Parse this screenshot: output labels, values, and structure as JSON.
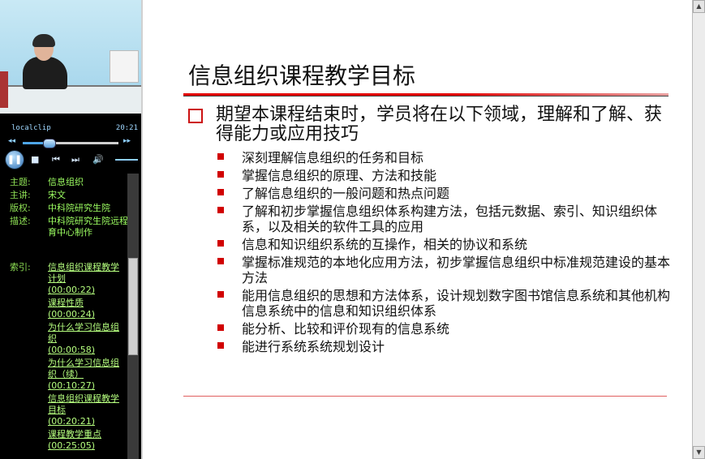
{
  "player": {
    "clip_name": "localclip",
    "time": "20:21",
    "progress_fraction": 0.27,
    "buttons": {
      "pause": "❚❚",
      "stop": "■",
      "prev": "⏮",
      "next": "⏭",
      "volume": "🔊",
      "rewind": "◂◂",
      "forward": "▸▸"
    },
    "icons": [
      "pause-icon",
      "stop-icon",
      "previous-icon",
      "next-icon",
      "volume-icon"
    ]
  },
  "meta": {
    "subject_label": "主题:",
    "subject_value": "信息组织",
    "speaker_label": "主讲:",
    "speaker_value": "宋文",
    "copyright_label": "版权:",
    "copyright_value": "中科院研究生院",
    "desc_label": "描述:",
    "desc_value": "中科院研究生院远程教育中心制作"
  },
  "index": {
    "label": "索引:",
    "items": [
      {
        "title": "信息组织课程教学计划",
        "time": "(00:00:22)"
      },
      {
        "title": "课程性质",
        "time": "(00:00:24)"
      },
      {
        "title": "为什么学习信息组织",
        "time": "(00:00:58)"
      },
      {
        "title": "为什么学习信息组织（续）",
        "time": "(00:10:27)"
      },
      {
        "title": "信息组织课程教学目标",
        "time": "(00:20:21)"
      },
      {
        "title": "课程教学重点",
        "time": "(00:25:05)"
      }
    ]
  },
  "slide": {
    "title": "信息组织课程教学目标",
    "main_point": "期望本课程结束时，学员将在以下领域，理解和了解、获得能力或应用技巧",
    "sub_points": [
      "深刻理解信息组织的任务和目标",
      "掌握信息组织的原理、方法和技能",
      "了解信息组织的一般问题和热点问题",
      "了解和初步掌握信息组织体系构建方法，包括元数据、索引、知识组织体系，以及相关的软件工具的应用",
      "信息和知识组织系统的互操作，相关的协议和系统",
      "掌握标准规范的本地化应用方法，初步掌握信息组织中标准规范建设的基本方法",
      "能用信息组织的思想和方法体系，设计规划数字图书馆信息系统和其他机构信息系统中的信息和知识组织体系",
      "能分析、比较和评价现有的信息系统",
      "能进行系统系统规划设计"
    ],
    "colors": {
      "accent": "#cc1111",
      "rule": "#e20000"
    }
  },
  "scrollbar": {
    "up": "▲",
    "down": "▼"
  }
}
